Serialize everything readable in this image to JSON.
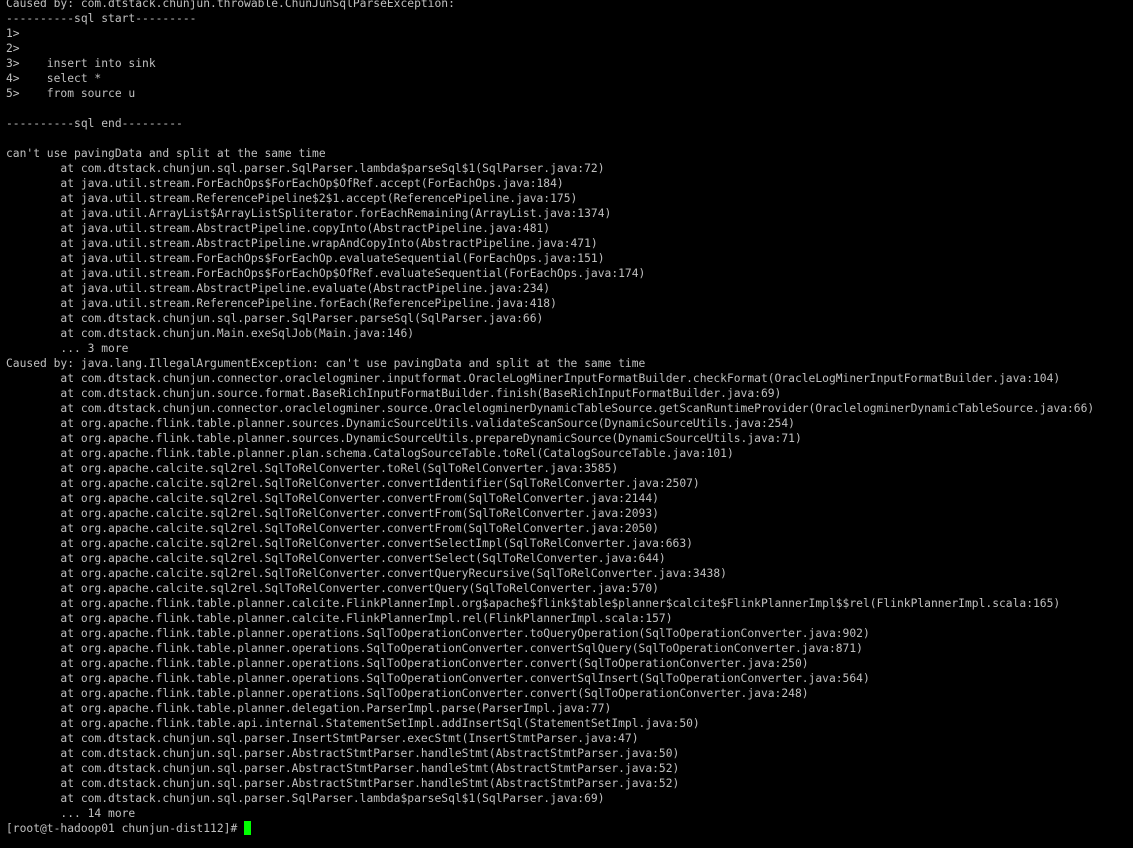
{
  "terminal": {
    "text_color": "#c0c0c0",
    "background_color": "#000000",
    "cursor_color": "#00ff00",
    "lines": [
      "Caused by: com.dtstack.chunjun.throwable.ChunJunSqlParseException:",
      "----------sql start---------",
      "1>",
      "2>",
      "3>    insert into sink",
      "4>    select *",
      "5>    from source u",
      "",
      "----------sql end---------",
      "",
      "can't use pavingData and split at the same time",
      "        at com.dtstack.chunjun.sql.parser.SqlParser.lambda$parseSql$1(SqlParser.java:72)",
      "        at java.util.stream.ForEachOps$ForEachOp$OfRef.accept(ForEachOps.java:184)",
      "        at java.util.stream.ReferencePipeline$2$1.accept(ReferencePipeline.java:175)",
      "        at java.util.ArrayList$ArrayListSpliterator.forEachRemaining(ArrayList.java:1374)",
      "        at java.util.stream.AbstractPipeline.copyInto(AbstractPipeline.java:481)",
      "        at java.util.stream.AbstractPipeline.wrapAndCopyInto(AbstractPipeline.java:471)",
      "        at java.util.stream.ForEachOps$ForEachOp.evaluateSequential(ForEachOps.java:151)",
      "        at java.util.stream.ForEachOps$ForEachOp$OfRef.evaluateSequential(ForEachOps.java:174)",
      "        at java.util.stream.AbstractPipeline.evaluate(AbstractPipeline.java:234)",
      "        at java.util.stream.ReferencePipeline.forEach(ReferencePipeline.java:418)",
      "        at com.dtstack.chunjun.sql.parser.SqlParser.parseSql(SqlParser.java:66)",
      "        at com.dtstack.chunjun.Main.exeSqlJob(Main.java:146)",
      "        ... 3 more",
      "Caused by: java.lang.IllegalArgumentException: can't use pavingData and split at the same time",
      "        at com.dtstack.chunjun.connector.oraclelogminer.inputformat.OracleLogMinerInputFormatBuilder.checkFormat(OracleLogMinerInputFormatBuilder.java:104)",
      "        at com.dtstack.chunjun.source.format.BaseRichInputFormatBuilder.finish(BaseRichInputFormatBuilder.java:69)",
      "        at com.dtstack.chunjun.connector.oraclelogminer.source.OraclelogminerDynamicTableSource.getScanRuntimeProvider(OraclelogminerDynamicTableSource.java:66)",
      "        at org.apache.flink.table.planner.sources.DynamicSourceUtils.validateScanSource(DynamicSourceUtils.java:254)",
      "        at org.apache.flink.table.planner.sources.DynamicSourceUtils.prepareDynamicSource(DynamicSourceUtils.java:71)",
      "        at org.apache.flink.table.planner.plan.schema.CatalogSourceTable.toRel(CatalogSourceTable.java:101)",
      "        at org.apache.calcite.sql2rel.SqlToRelConverter.toRel(SqlToRelConverter.java:3585)",
      "        at org.apache.calcite.sql2rel.SqlToRelConverter.convertIdentifier(SqlToRelConverter.java:2507)",
      "        at org.apache.calcite.sql2rel.SqlToRelConverter.convertFrom(SqlToRelConverter.java:2144)",
      "        at org.apache.calcite.sql2rel.SqlToRelConverter.convertFrom(SqlToRelConverter.java:2093)",
      "        at org.apache.calcite.sql2rel.SqlToRelConverter.convertFrom(SqlToRelConverter.java:2050)",
      "        at org.apache.calcite.sql2rel.SqlToRelConverter.convertSelectImpl(SqlToRelConverter.java:663)",
      "        at org.apache.calcite.sql2rel.SqlToRelConverter.convertSelect(SqlToRelConverter.java:644)",
      "        at org.apache.calcite.sql2rel.SqlToRelConverter.convertQueryRecursive(SqlToRelConverter.java:3438)",
      "        at org.apache.calcite.sql2rel.SqlToRelConverter.convertQuery(SqlToRelConverter.java:570)",
      "        at org.apache.flink.table.planner.calcite.FlinkPlannerImpl.org$apache$flink$table$planner$calcite$FlinkPlannerImpl$$rel(FlinkPlannerImpl.scala:165)",
      "        at org.apache.flink.table.planner.calcite.FlinkPlannerImpl.rel(FlinkPlannerImpl.scala:157)",
      "        at org.apache.flink.table.planner.operations.SqlToOperationConverter.toQueryOperation(SqlToOperationConverter.java:902)",
      "        at org.apache.flink.table.planner.operations.SqlToOperationConverter.convertSqlQuery(SqlToOperationConverter.java:871)",
      "        at org.apache.flink.table.planner.operations.SqlToOperationConverter.convert(SqlToOperationConverter.java:250)",
      "        at org.apache.flink.table.planner.operations.SqlToOperationConverter.convertSqlInsert(SqlToOperationConverter.java:564)",
      "        at org.apache.flink.table.planner.operations.SqlToOperationConverter.convert(SqlToOperationConverter.java:248)",
      "        at org.apache.flink.table.planner.delegation.ParserImpl.parse(ParserImpl.java:77)",
      "        at org.apache.flink.table.api.internal.StatementSetImpl.addInsertSql(StatementSetImpl.java:50)",
      "        at com.dtstack.chunjun.sql.parser.InsertStmtParser.execStmt(InsertStmtParser.java:47)",
      "        at com.dtstack.chunjun.sql.parser.AbstractStmtParser.handleStmt(AbstractStmtParser.java:50)",
      "        at com.dtstack.chunjun.sql.parser.AbstractStmtParser.handleStmt(AbstractStmtParser.java:52)",
      "        at com.dtstack.chunjun.sql.parser.AbstractStmtParser.handleStmt(AbstractStmtParser.java:52)",
      "        at com.dtstack.chunjun.sql.parser.SqlParser.lambda$parseSql$1(SqlParser.java:69)",
      "        ... 14 more"
    ],
    "prompt": "[root@t-hadoop01 chunjun-dist112]#"
  }
}
